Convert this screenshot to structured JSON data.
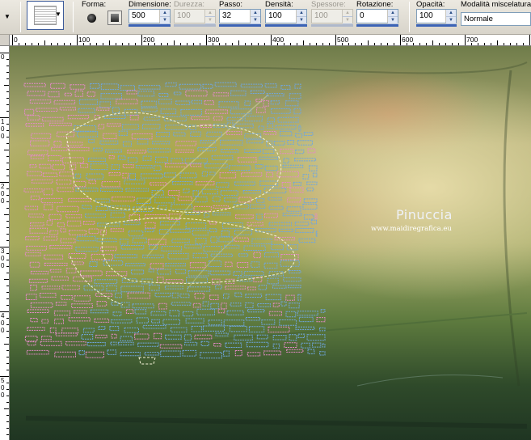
{
  "toolbar": {
    "forma_label": "Forma:",
    "dimensione_label": "Dimensione:",
    "dimensione_value": "500",
    "durezza_label": "Durezza:",
    "durezza_value": "100",
    "passo_label": "Passo:",
    "passo_value": "32",
    "densita_label": "Densità:",
    "densita_value": "100",
    "spessore_label": "Spessore:",
    "spessore_value": "100",
    "rotazione_label": "Rotazione:",
    "rotazione_value": "0",
    "opacita_label": "Opacità:",
    "opacita_value": "100",
    "blend_label": "Modalità miscelatura:",
    "blend_value": "Normale",
    "disabled_fields": [
      "durezza",
      "spessore"
    ]
  },
  "ruler_top": {
    "labels": [
      "0",
      "100",
      "200",
      "300",
      "400",
      "500",
      "600",
      "700"
    ]
  },
  "ruler_left": {
    "labels": [
      "0",
      "100",
      "200",
      "300",
      "400",
      "500"
    ]
  },
  "canvas": {
    "watermark_title": "Pinuccia",
    "watermark_url": "www.maidiregrafica.eu"
  },
  "icons": {
    "round_shape": "round-brush-shape-icon",
    "square_shape": "square-brush-shape-icon",
    "brush_preview": "brush-preview-icon",
    "dropdown": "chevron-down-icon"
  },
  "colors": {
    "spin_accent": "#3b63b6",
    "toolbar_bg": "#d8d4ca",
    "marching_ants_pink": "#e48ac8",
    "marching_ants_blue": "#6fa6e0"
  }
}
